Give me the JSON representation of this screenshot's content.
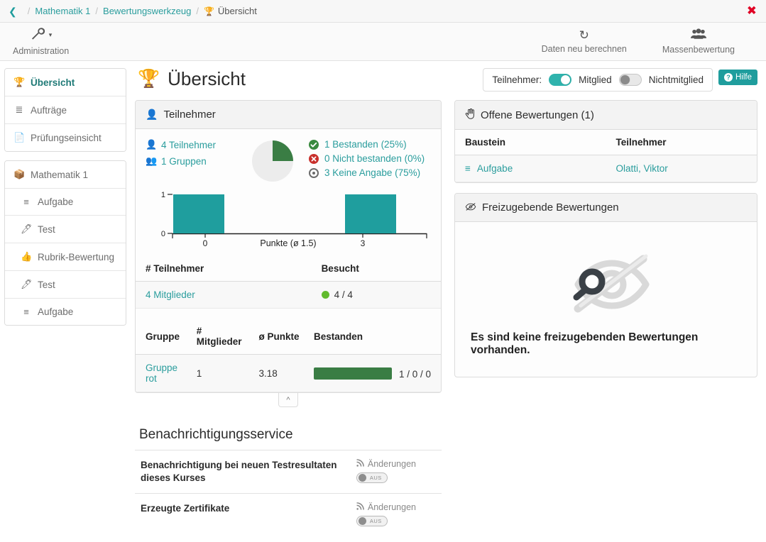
{
  "breadcrumb": {
    "back_icon": "chevron-left",
    "items": [
      {
        "label": "Mathematik 1",
        "type": "link"
      },
      {
        "label": "Bewertungswerkzeug",
        "type": "link"
      },
      {
        "label": "Übersicht",
        "type": "current",
        "icon": "trophy-icon"
      }
    ],
    "separator": "/",
    "close_label": "✖"
  },
  "toolbar": {
    "left": [
      {
        "label": "Administration",
        "icon": "wrench-icon",
        "caret": "▾"
      }
    ],
    "right": [
      {
        "label": "Daten neu berechnen",
        "icon": "refresh-icon"
      },
      {
        "label": "Massenbewertung",
        "icon": "users-icon"
      }
    ]
  },
  "sidebar": {
    "group1": [
      {
        "label": "Übersicht",
        "icon": "trophy-icon",
        "active": true
      },
      {
        "label": "Aufträge",
        "icon": "list-icon",
        "active": false
      },
      {
        "label": "Prüfungseinsicht",
        "icon": "file-icon",
        "active": false
      }
    ],
    "group2": [
      {
        "label": "Mathematik 1",
        "icon": "package-icon",
        "indent": false
      },
      {
        "label": "Aufgabe",
        "icon": "task-icon",
        "indent": true
      },
      {
        "label": "Test",
        "icon": "pencil-square-icon",
        "indent": true
      },
      {
        "label": "Rubrik-Bewertung",
        "icon": "thumbs-up-icon",
        "indent": true
      },
      {
        "label": "Test",
        "icon": "pencil-square-icon",
        "indent": true
      },
      {
        "label": "Aufgabe",
        "icon": "task-icon",
        "indent": true
      }
    ]
  },
  "page": {
    "title": "Übersicht",
    "title_icon": "trophy-icon"
  },
  "participants_panel": {
    "header": "Teilnehmer",
    "header_icon": "user-icon",
    "counts": [
      {
        "label": "4 Teilnehmer",
        "icon": "user-icon"
      },
      {
        "label": "1 Gruppen",
        "icon": "users-icon"
      }
    ],
    "legend": [
      {
        "label": "1 Bestanden (25%)",
        "icon": "check-circle-icon",
        "color": "#3a8a3f"
      },
      {
        "label": "0 Nicht bestanden (0%)",
        "icon": "x-circle-icon",
        "color": "#c9302c"
      },
      {
        "label": "3 Keine Angabe (75%)",
        "icon": "dot-circle-icon",
        "color": "#6b6b6b"
      }
    ],
    "members_table": {
      "columns": [
        "# Teilnehmer",
        "Besucht"
      ],
      "rows": [
        {
          "participants": "4 Mitglieder",
          "visited": "4 / 4",
          "dot_color": "#62bb2e"
        }
      ]
    },
    "groups_table": {
      "columns": [
        "Gruppe",
        "# Mitglieder",
        "ø Punkte",
        "Bestanden"
      ],
      "rows": [
        {
          "group": "Gruppe rot",
          "members": "1",
          "avg_points": "3.18",
          "passed": "1 / 0 / 0",
          "bar_pct": 100
        }
      ]
    },
    "collapse_icon": "chevron-up-icon"
  },
  "chart_data": [
    {
      "type": "pie",
      "title": "Teilnehmer Bestanden-Verteilung",
      "labels": [
        "Bestanden",
        "Nicht bestanden",
        "Keine Angabe"
      ],
      "values": [
        25,
        0,
        75
      ],
      "counts": [
        1,
        0,
        3
      ],
      "colors": [
        "#3a7d44",
        "#c9302c",
        "#ececec"
      ],
      "legend": "right"
    },
    {
      "type": "bar",
      "title": "",
      "categories": [
        "0",
        "3"
      ],
      "values": [
        1,
        1
      ],
      "xlabel": "Punkte (ø 1.5)",
      "ylabel": "",
      "ylim": [
        0,
        1
      ],
      "yticks": [
        "0",
        "1"
      ],
      "xticks": [
        "0",
        "3"
      ],
      "bar_color": "#1f9e9e",
      "grid": false
    }
  ],
  "notification": {
    "title": "Benachrichtigungsservice",
    "rows": [
      {
        "label": "Benachrichtigung bei neuen Testresultaten dieses Kurses",
        "changes_label": "Änderungen",
        "changes_icon": "rss-icon",
        "toggle_state": "AUS"
      },
      {
        "label": "Erzeugte Zertifikate",
        "changes_label": "Änderungen",
        "changes_icon": "rss-icon",
        "toggle_state": "AUS"
      }
    ]
  },
  "filter_bar": {
    "label": "Teilnehmer:",
    "toggles": [
      {
        "label": "Mitglied",
        "on": true
      },
      {
        "label": "Nichtmitglied",
        "on": false
      }
    ],
    "help_label": "Hilfe",
    "help_icon": "question-circle-icon"
  },
  "open_assessments": {
    "header": "Offene Bewertungen (1)",
    "header_icon": "hand-pointer-icon",
    "columns": [
      "Baustein",
      "Teilnehmer"
    ],
    "rows": [
      {
        "baustein": "Aufgabe",
        "baustein_icon": "task-icon",
        "teilnehmer": "Olatti, Viktor"
      }
    ]
  },
  "release_assessments": {
    "header": "Freizugebende Bewertungen",
    "header_icon": "eye-slash-icon",
    "empty_message": "Es sind keine freizugebenden Bewertungen vorhanden.",
    "empty_icon": "search-eye-slash-icon"
  },
  "colors": {
    "accent_teal": "#2a9d9d",
    "bar_teal": "#1f9e9e",
    "green": "#3a7d44",
    "bright_green": "#62bb2e",
    "red": "#c9302c",
    "close_red": "#e00024"
  }
}
